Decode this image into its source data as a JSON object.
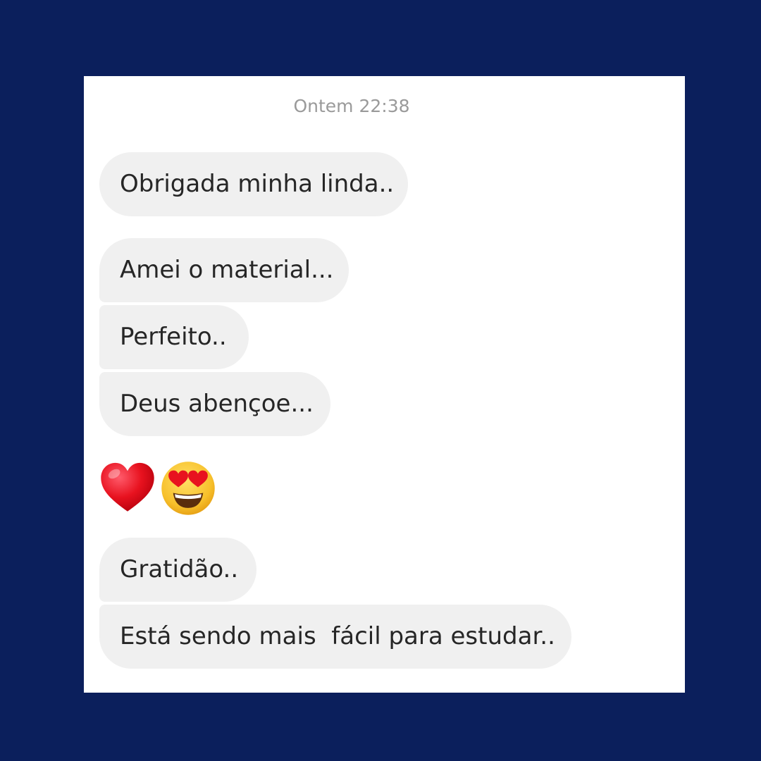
{
  "conversation": {
    "timestamp": "Ontem 22:38",
    "messages": [
      "Obrigada minha linda..",
      "Amei o material...",
      "Perfeito..",
      "Deus abençoe...",
      "Gratidão..",
      "Está sendo mais  fácil para estudar.."
    ],
    "emoji_message": {
      "icons": [
        "red-heart-icon",
        "heart-eyes-face-icon"
      ]
    }
  },
  "colors": {
    "page_background": "#0b1f5c",
    "card_background": "#ffffff",
    "bubble_background": "#f0f0f0",
    "message_text": "#262626",
    "timestamp_text": "#9a9a9a"
  }
}
